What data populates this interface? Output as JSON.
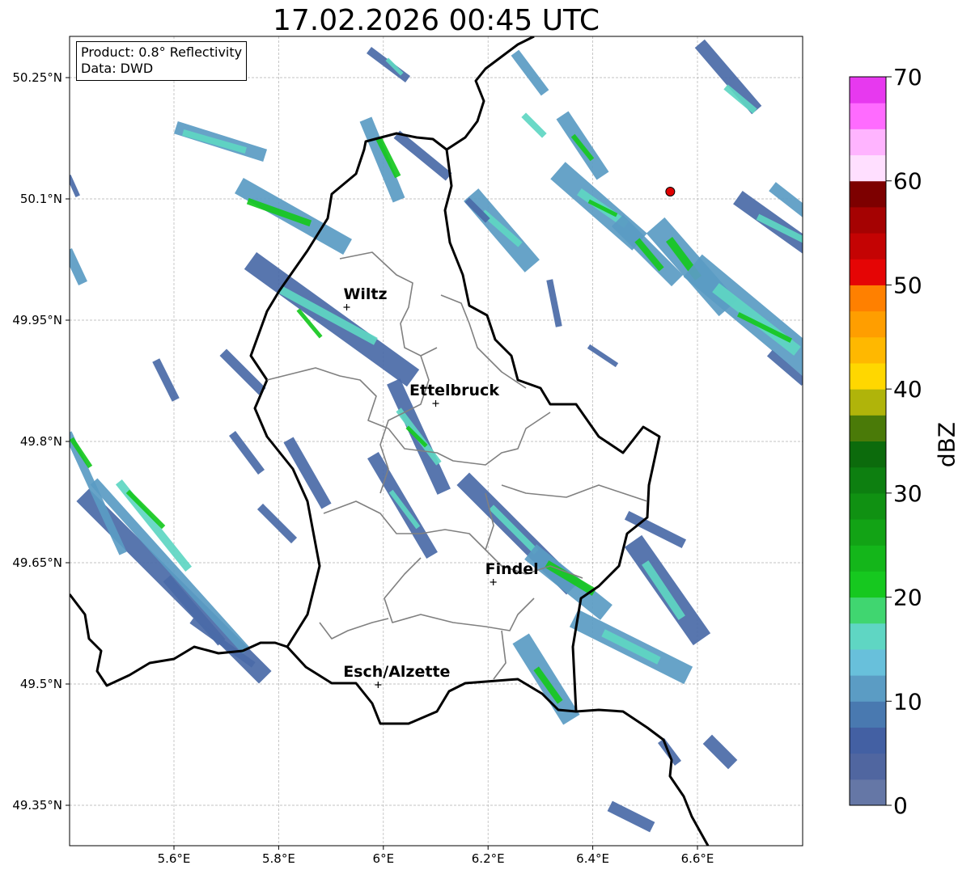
{
  "title": "17.02.2026 00:45 UTC",
  "info": {
    "product": "Product: 0.8° Reflectivity",
    "data": "Data: DWD"
  },
  "map": {
    "lon_range": [
      5.4,
      6.8
    ],
    "lat_range": [
      49.3,
      50.3
    ],
    "x_ticks": [
      {
        "value": 5.6,
        "label": "5.6°E"
      },
      {
        "value": 5.8,
        "label": "5.8°E"
      },
      {
        "value": 6.0,
        "label": "6°E"
      },
      {
        "value": 6.2,
        "label": "6.2°E"
      },
      {
        "value": 6.4,
        "label": "6.4°E"
      },
      {
        "value": 6.6,
        "label": "6.6°E"
      }
    ],
    "y_ticks": [
      {
        "value": 50.25,
        "label": "50.25°N"
      },
      {
        "value": 50.1,
        "label": "50.1°N"
      },
      {
        "value": 49.95,
        "label": "49.95°N"
      },
      {
        "value": 49.8,
        "label": "49.8°N"
      },
      {
        "value": 49.65,
        "label": "49.65°N"
      },
      {
        "value": 49.5,
        "label": "49.5°N"
      },
      {
        "value": 49.35,
        "label": "49.35°N"
      }
    ],
    "cities": [
      {
        "name": "Wiltz",
        "lon": 5.93,
        "lat": 49.966
      },
      {
        "name": "Ettelbruck",
        "lon": 6.1,
        "lat": 49.847
      },
      {
        "name": "Findel",
        "lon": 6.21,
        "lat": 49.626
      },
      {
        "name": "Esch/Alzette",
        "lon": 5.99,
        "lat": 49.499
      }
    ],
    "radar_site": {
      "lon": 6.548,
      "lat": 50.109,
      "color": "#e00000"
    },
    "border_color": "#000000",
    "canton_color": "#808080"
  },
  "colorbar": {
    "label": "dBZ",
    "min": 0,
    "max": 70,
    "ticks": [
      "0",
      "10",
      "20",
      "30",
      "40",
      "50",
      "60",
      "70"
    ],
    "colors": [
      "#6577a6",
      "#5066a0",
      "#4360a3",
      "#4979b0",
      "#5b9cc4",
      "#68c0db",
      "#5fd6c3",
      "#40d670",
      "#16c81f",
      "#14b61a",
      "#12a315",
      "#109112",
      "#0d7f10",
      "#0c6b0c",
      "#4a7a08",
      "#b0b40a",
      "#ffd700",
      "#ffb800",
      "#ff9e00",
      "#ff8000",
      "#e50505",
      "#c40303",
      "#a50202",
      "#7d0000",
      "#ffdfff",
      "#ffb4ff",
      "#ff6bff",
      "#e739ef"
    ]
  },
  "echo_colors": {
    "light": "#4a6ba8",
    "mid": "#5b9cc4",
    "cyan": "#5fd6c3",
    "green": "#16c81f"
  }
}
